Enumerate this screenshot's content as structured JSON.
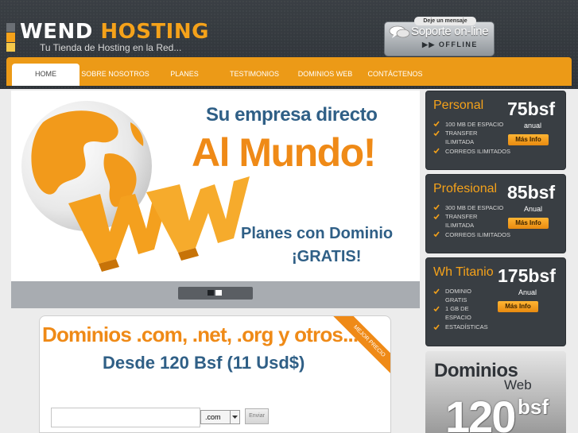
{
  "brand": {
    "name_part1": "WEND",
    "name_part2": "HOSTING",
    "tagline": "Tu Tienda de Hosting en la Red...",
    "colors": {
      "orange": "#f5a21a",
      "dark": "#393e43",
      "blue": "#2f5f86"
    }
  },
  "support": {
    "leave_message": "Deje un mensaje",
    "title": "Soporte on-line",
    "status": "OFFLINE",
    "icon": "chat-bubbles-icon"
  },
  "nav": {
    "items": [
      {
        "label": "HOME",
        "active": true
      },
      {
        "label": "SOBRE NOSOTROS",
        "active": false
      },
      {
        "label": "PLANES",
        "active": false
      },
      {
        "label": "TESTIMONIOS",
        "active": false
      },
      {
        "label": "DOMINIOS WEB",
        "active": false
      },
      {
        "label": "CONTÁCTENOS",
        "active": false
      }
    ]
  },
  "banner": {
    "line1": "Su empresa directo",
    "line2": "Al Mundo!",
    "line3": "Planes con Dominio",
    "line4": "¡GRATIS!",
    "graphic_text": "WWW",
    "slides": 2,
    "active_slide": 1
  },
  "plans": [
    {
      "name": "Personal",
      "price": "75bsf",
      "period": "anual",
      "features": [
        "100 MB DE ESPACIO",
        "TRANSFER ILIMITADA",
        "CORREOS ILIMITADOS"
      ],
      "button": "Más Info"
    },
    {
      "name": "Profesional",
      "price": "85bsf",
      "period": "Anual",
      "features": [
        "300 MB DE ESPACIO",
        "TRANSFER ILIMITADA",
        "CORREOS ILIMITADOS"
      ],
      "button": "Más Info"
    },
    {
      "name": "Wh Titanio",
      "price": "175bsf",
      "period": "Anual",
      "features": [
        "DOMINIO GRATIS",
        "1 GB DE ESPACIO",
        "ESTADÍSTICAS"
      ],
      "button": "Más Info"
    }
  ],
  "domains": {
    "title": "Dominios .com, .net, .org y otros...",
    "subtitle": "Desde 120 Bsf (11 Usd$)",
    "ribbon": "MEJOR PRECIO",
    "input_value": "",
    "tld_selected": ".com",
    "submit": "Enviar"
  },
  "domains_web": {
    "title": "Dominios",
    "subtitle": "Web",
    "price": "120",
    "unit": "bsf"
  }
}
